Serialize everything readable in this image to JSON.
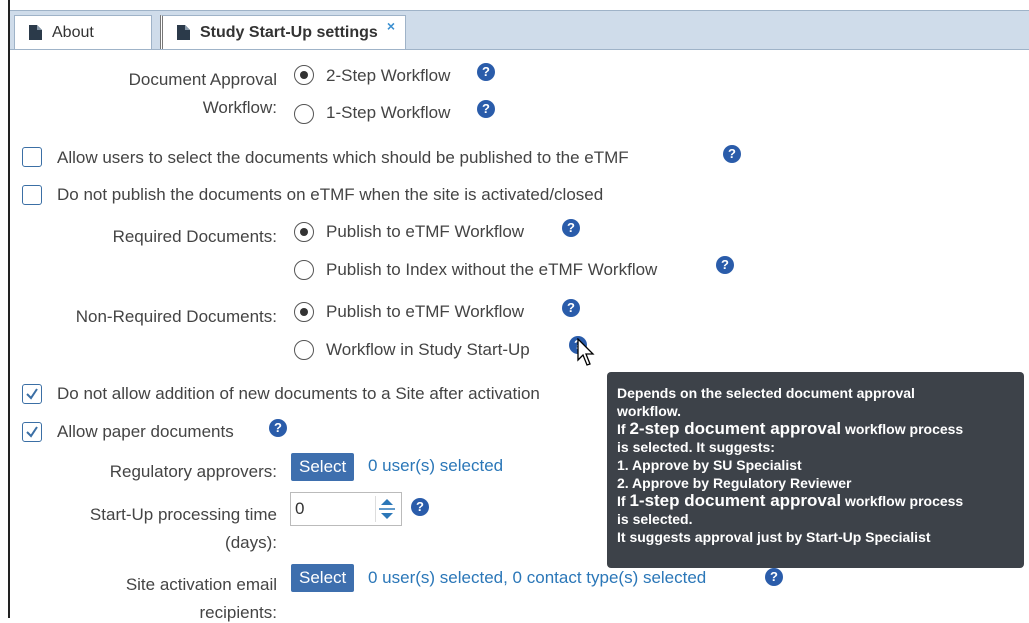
{
  "tabs": [
    {
      "label": "About",
      "active": false
    },
    {
      "label": "Study Start-Up settings",
      "active": true,
      "close": "×"
    }
  ],
  "approval": {
    "label": "Document Approval Workflow:",
    "label_line1": "Document Approval",
    "label_line2": "Workflow:",
    "options": [
      "2-Step Workflow",
      "1-Step Workflow"
    ],
    "selected": 0
  },
  "checkboxes": {
    "allow_select_docs": {
      "label": "Allow users to select the documents which should be published to the eTMF",
      "checked": false
    },
    "no_publish": {
      "label": "Do not publish the documents on eTMF when the site is activated/closed",
      "checked": false
    },
    "no_addition": {
      "label": "Do not allow addition of new documents to a Site after activation",
      "checked": true
    },
    "paper_docs": {
      "label": "Allow paper documents",
      "checked": true
    }
  },
  "required_docs": {
    "label": "Required Documents:",
    "options": [
      "Publish to eTMF Workflow",
      "Publish to Index without the eTMF Workflow"
    ],
    "selected": 0
  },
  "non_required_docs": {
    "label": "Non-Required Documents:",
    "options": [
      "Publish to eTMF Workflow",
      "Workflow in Study Start-Up"
    ],
    "selected": 0
  },
  "regulatory": {
    "label": "Regulatory approvers:",
    "button": "Select",
    "status": "0 user(s) selected"
  },
  "processing_time": {
    "label_line1": "Start-Up processing time",
    "label_line2": "(days):",
    "value": "0"
  },
  "activation_email": {
    "label_line1": "Site activation email",
    "label_line2": "recipients:",
    "button": "Select",
    "status": "0 user(s) selected, 0 contact type(s) selected"
  },
  "help_glyph": "?",
  "tooltip": {
    "line1": "Depends on the selected document approval",
    "line2": "workflow.",
    "line3_prefix": "If ",
    "line3_bold": "2-step document approval",
    "line3_suffix": " workflow process",
    "line4": "is selected. It suggests:",
    "line5": "1. Approve by SU Specialist",
    "line6": "2. Approve by Regulatory Reviewer",
    "line7_prefix": "If ",
    "line7_bold": "1-step document approval",
    "line7_suffix": " workflow process",
    "line8": "is selected.",
    "line9": "It suggests approval just by Start-Up Specialist"
  },
  "colors": {
    "accent": "#3e6fae",
    "link": "#2b77b8",
    "help": "#2a5caa",
    "tooltip_bg": "#3d4249",
    "tab_bar": "#cfdcea"
  }
}
